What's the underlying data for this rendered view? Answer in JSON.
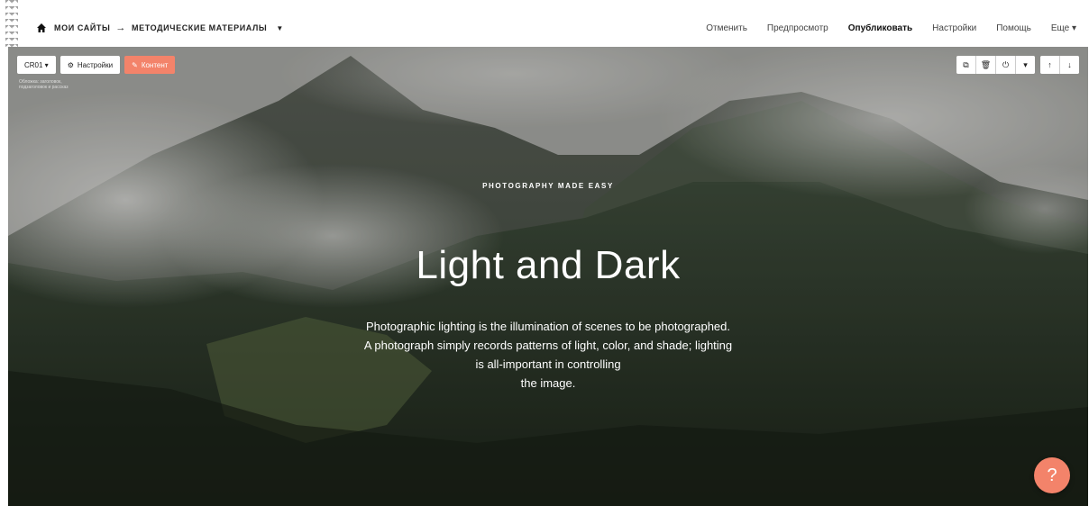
{
  "topbar": {
    "breadcrumb": {
      "root": "МОИ САЙТЫ",
      "separator": "→",
      "current": "МЕТОДИЧЕСКИЕ МАТЕРИАЛЫ"
    },
    "nav": {
      "cancel": "Отменить",
      "preview": "Предпросмотр",
      "publish": "Опубликовать",
      "settings": "Настройки",
      "help": "Помощь",
      "more": "Еще ▾"
    }
  },
  "block": {
    "id_label": "CR01 ▾",
    "settings_label": "Настройки",
    "content_label": "Контент",
    "hint": "Обложка: заголовок, подзаголовок и рассказ",
    "colors": {
      "accent": "#f3836a"
    }
  },
  "hero": {
    "eyebrow": "PHOTOGRAPHY MADE EASY",
    "title": "Light and Dark",
    "text_lines": [
      "Photographic lighting is the illumination of scenes to be photographed.",
      "A photograph simply records patterns of light, color, and shade; lighting",
      "is all-important in controlling",
      "the image."
    ]
  },
  "help_button": {
    "label": "?"
  }
}
